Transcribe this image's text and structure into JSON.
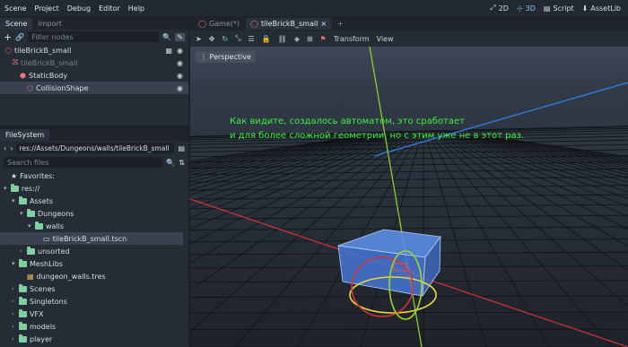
{
  "menu": [
    "Scene",
    "Project",
    "Debug",
    "Editor",
    "Help"
  ],
  "workspaces": [
    {
      "label": "2D",
      "active": false
    },
    {
      "label": "3D",
      "active": true
    },
    {
      "label": "Script",
      "active": false
    },
    {
      "label": "AssetLib",
      "active": false
    }
  ],
  "scene_dock": {
    "tabs": [
      "Scene",
      "Import"
    ],
    "filter_placeholder": "Filter nodes",
    "nodes": [
      {
        "label": "tileBrickB_small",
        "indent": 0,
        "extra_icon": true
      },
      {
        "label": "tileBrickB_small",
        "indent": 1,
        "dim": true
      },
      {
        "label": "StaticBody",
        "indent": 2
      },
      {
        "label": "CollisionShape",
        "indent": 3,
        "selected": true
      }
    ]
  },
  "filesystem": {
    "tab": "FileSystem",
    "path": "res://Assets/Dungeons/walls/tileBrickB_small",
    "search_placeholder": "Search files",
    "favorites": "Favorites:",
    "items": [
      {
        "label": "res://",
        "indent": 0,
        "type": "folder",
        "arrow": "▾"
      },
      {
        "label": "Assets",
        "indent": 1,
        "type": "folder",
        "arrow": "▾"
      },
      {
        "label": "Dungeons",
        "indent": 2,
        "type": "folder",
        "arrow": "▾"
      },
      {
        "label": "walls",
        "indent": 3,
        "type": "folder",
        "arrow": "▾"
      },
      {
        "label": "tileBrickB_small.tscn",
        "indent": 4,
        "type": "scene",
        "selected": true
      },
      {
        "label": "unsorted",
        "indent": 2,
        "type": "folder",
        "arrow": "›"
      },
      {
        "label": "MeshLibs",
        "indent": 1,
        "type": "folder",
        "arrow": "▾"
      },
      {
        "label": "dungeon_walls.tres",
        "indent": 2,
        "type": "resource"
      },
      {
        "label": "Scenes",
        "indent": 1,
        "type": "folder",
        "arrow": "›"
      },
      {
        "label": "Singletons",
        "indent": 1,
        "type": "folder",
        "arrow": "›"
      },
      {
        "label": "VFX",
        "indent": 1,
        "type": "folder",
        "arrow": "›"
      },
      {
        "label": "models",
        "indent": 1,
        "type": "folder",
        "arrow": "›"
      },
      {
        "label": "player",
        "indent": 1,
        "type": "folder",
        "arrow": "›"
      }
    ]
  },
  "editor_tabs": [
    {
      "label": "Game(*)",
      "active": false
    },
    {
      "label": "tileBrickB_small",
      "active": true
    }
  ],
  "toolbar": {
    "transform": "Transform",
    "view": "View"
  },
  "viewport": {
    "perspective_label": "Perspective",
    "caption_line1": "Как видите, создалось автоматом, это сработает",
    "caption_line2": "и для более сложной геометрии, но с этим уже не в этот раз."
  },
  "colors": {
    "accent": "#8ec2ff",
    "caption": "#3df03d",
    "x_axis": "#d6323a",
    "y_axis": "#9bd62a",
    "z_axis": "#2f7de0"
  }
}
